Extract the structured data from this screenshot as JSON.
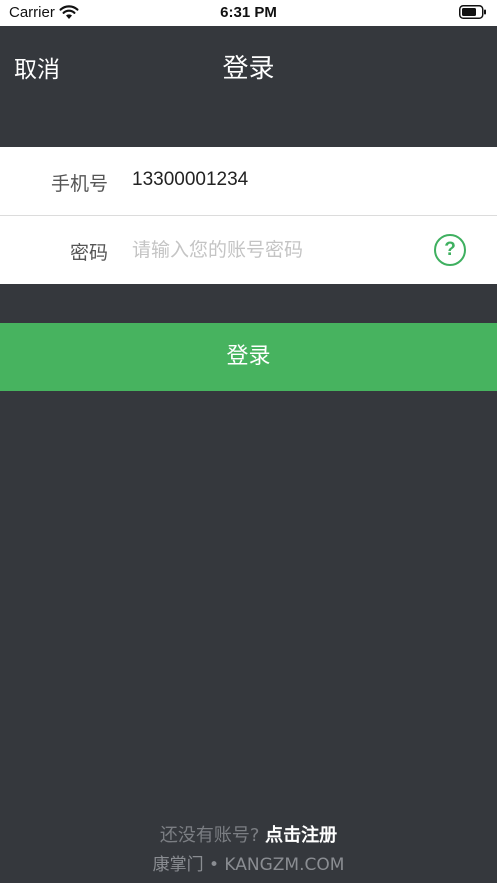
{
  "status_bar": {
    "carrier": "Carrier",
    "time": "6:31 PM",
    "wifi_icon": "wifi-icon",
    "battery_icon": "battery-icon"
  },
  "nav": {
    "cancel_label": "取消",
    "title": "登录"
  },
  "form": {
    "phone_label": "手机号",
    "phone_value": "13300001234",
    "password_label": "密码",
    "password_placeholder": "请输入您的账号密码",
    "help_icon": "question-circle-icon",
    "help_glyph": "?"
  },
  "login_button": {
    "label": "登录"
  },
  "footer": {
    "register_prompt": "还没有账号?",
    "register_link": "点击注册",
    "brand": "康掌门 • KANGZM.COM"
  },
  "colors": {
    "background": "#35383d",
    "accent_green": "#47b35f",
    "white": "#ffffff"
  }
}
